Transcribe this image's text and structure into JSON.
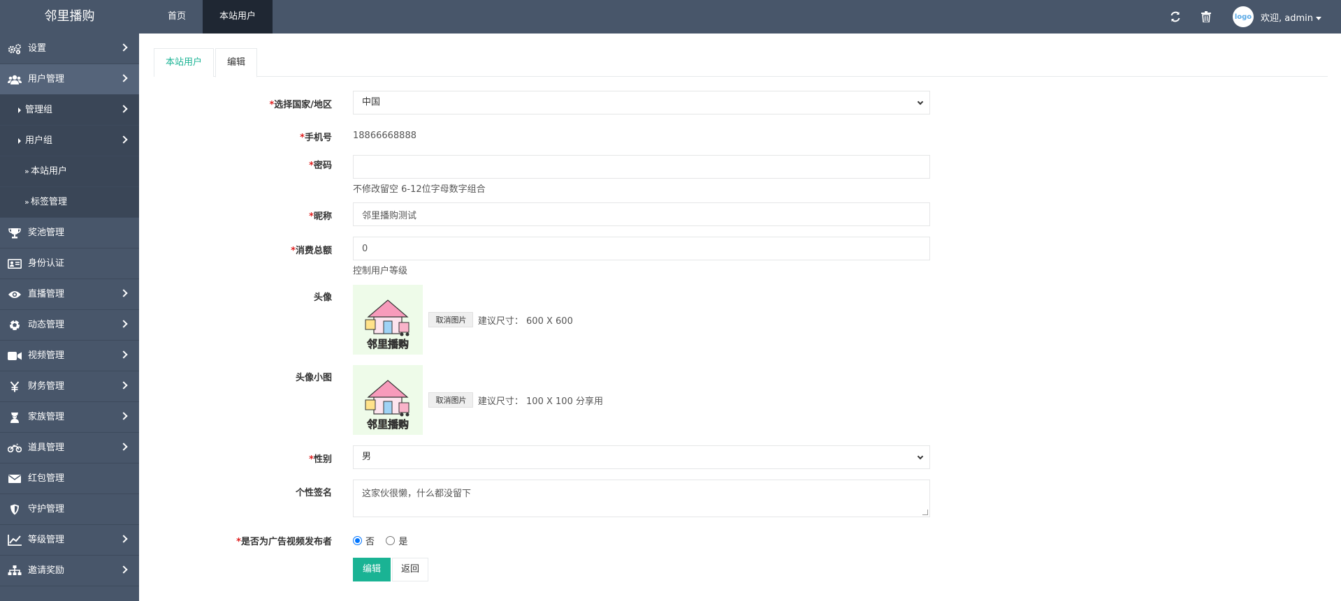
{
  "brand": {
    "title": "邻里播购"
  },
  "topnav": {
    "items": [
      {
        "label": "首页"
      },
      {
        "label": "本站用户"
      }
    ]
  },
  "topright": {
    "avatar_text": "logo",
    "welcome": "欢迎, admin"
  },
  "sidebar": {
    "items": [
      {
        "label": "设置",
        "icon": "gears-icon"
      },
      {
        "label": "用户管理",
        "icon": "users-icon"
      },
      {
        "label": "管理组"
      },
      {
        "label": "用户组"
      },
      {
        "label": "本站用户"
      },
      {
        "label": "标签管理"
      },
      {
        "label": "奖池管理",
        "icon": "trophy-icon"
      },
      {
        "label": "身份认证",
        "icon": "id-card-icon"
      },
      {
        "label": "直播管理",
        "icon": "eye-icon"
      },
      {
        "label": "动态管理",
        "icon": "soccer-ball-icon"
      },
      {
        "label": "视频管理",
        "icon": "video-camera-icon"
      },
      {
        "label": "财务管理",
        "icon": "yen-icon"
      },
      {
        "label": "家族管理",
        "icon": "family-icon"
      },
      {
        "label": "道具管理",
        "icon": "motorcycle-icon"
      },
      {
        "label": "红包管理",
        "icon": "envelope-icon"
      },
      {
        "label": "守护管理",
        "icon": "shield-icon"
      },
      {
        "label": "等级管理",
        "icon": "line-chart-icon"
      },
      {
        "label": "邀请奖励",
        "icon": "sitemap-icon"
      }
    ]
  },
  "tabs": [
    {
      "label": "本站用户"
    },
    {
      "label": "编辑"
    }
  ],
  "form": {
    "country": {
      "label": "选择国家/地区",
      "value": "中国"
    },
    "phone": {
      "label": "手机号",
      "value": "18866668888"
    },
    "password": {
      "label": "密码",
      "value": "",
      "help": "不修改留空 6-12位字母数字组合"
    },
    "nickname": {
      "label": "昵称",
      "value": "邻里播购测试"
    },
    "consume": {
      "label": "消费总额",
      "value": "0",
      "help": "控制用户等级"
    },
    "avatar": {
      "label": "头像",
      "cancel": "取消图片",
      "hint": "建议尺寸： 600 X 600",
      "logo_text": "邻里播购"
    },
    "avatar_thumb": {
      "label": "头像小图",
      "cancel": "取消图片",
      "hint": "建议尺寸： 100 X 100 分享用",
      "logo_text": "邻里播购"
    },
    "gender": {
      "label": "性别",
      "value": "男"
    },
    "signature": {
      "label": "个性签名",
      "value": "这家伙很懒，什么都没留下"
    },
    "ad_publisher": {
      "label": "是否为广告视频发布者",
      "options": [
        {
          "label": "否",
          "checked": true
        },
        {
          "label": "是",
          "checked": false
        }
      ]
    },
    "submit": "编辑",
    "back": "返回",
    "required_mark": "*"
  }
}
